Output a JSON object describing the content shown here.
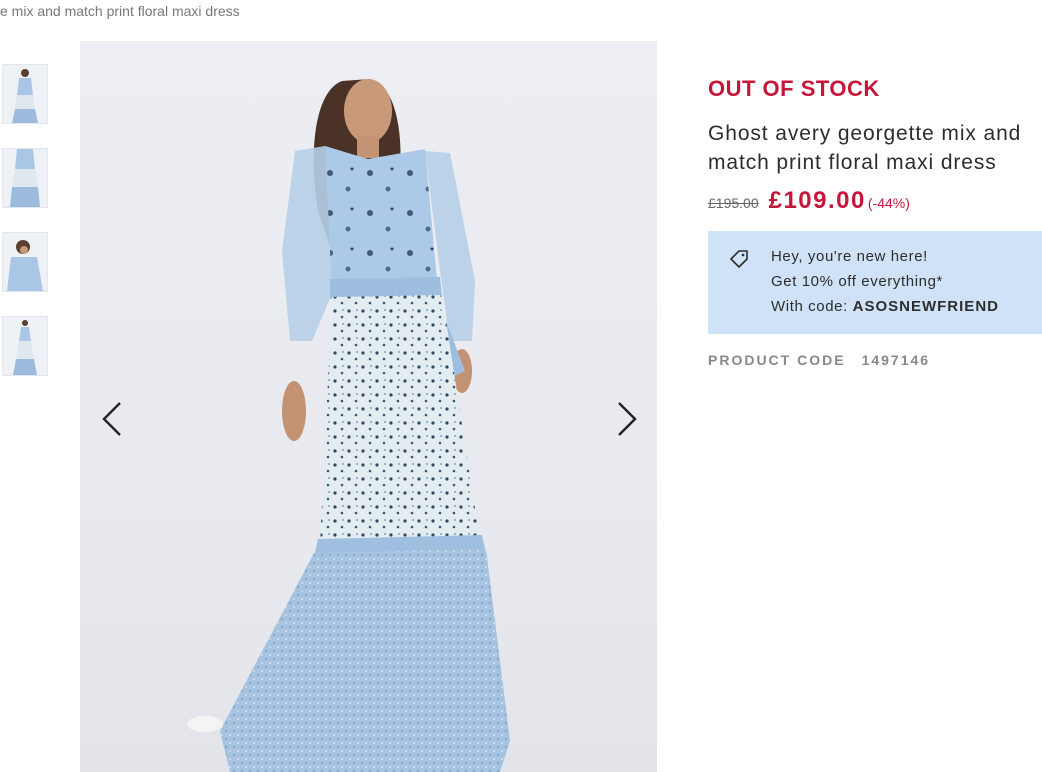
{
  "breadcrumb": "e mix and match print floral maxi dress",
  "gallery": {
    "thumbnails": [
      "thumbnail-1",
      "thumbnail-2",
      "thumbnail-3",
      "thumbnail-4"
    ],
    "prev_icon": "chevron-left-icon",
    "next_icon": "chevron-right-icon"
  },
  "product": {
    "stock_status": "OUT OF STOCK",
    "title": "Ghost avery georgette mix and match print floral maxi dress",
    "price_was": "£195.00",
    "price_now": "£109.00",
    "discount": "(-44%)",
    "code_label": "PRODUCT CODE",
    "code_value": "1497146"
  },
  "promo": {
    "icon": "tag-icon",
    "line1": "Hey, you're new here!",
    "line2": "Get 10% off everything*",
    "line3_prefix": "With code: ",
    "code": "ASOSNEWFRIEND"
  },
  "colors": {
    "accent": "#c5173a",
    "promo_bg": "#cfe2f7",
    "dress_top": "#a9c6e6",
    "dress_bottom": "#9dbbdc"
  }
}
